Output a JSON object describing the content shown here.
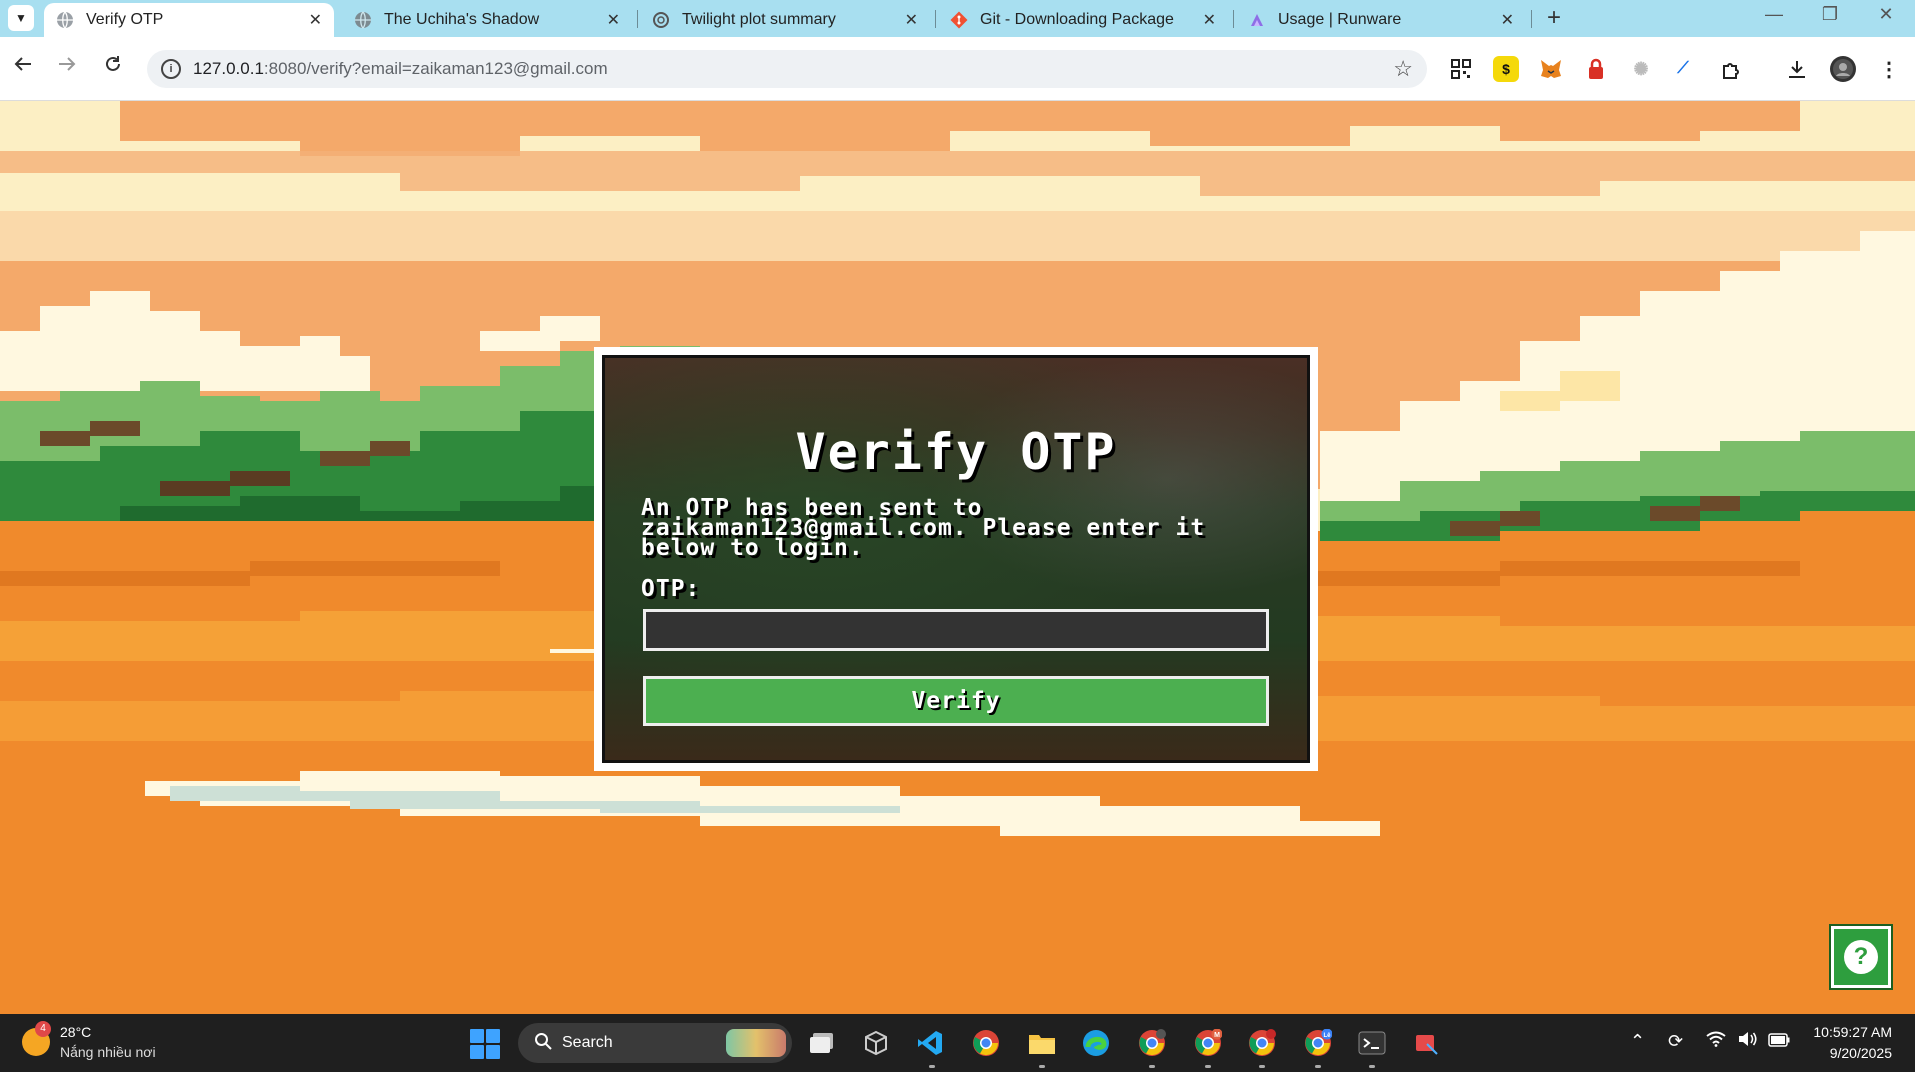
{
  "browser": {
    "tabs": [
      {
        "title": "Verify OTP",
        "favicon": "globe-icon",
        "active": true
      },
      {
        "title": "The Uchiha's Shadow",
        "favicon": "globe-icon",
        "active": false
      },
      {
        "title": "Twilight plot summary",
        "favicon": "openai-icon",
        "active": false
      },
      {
        "title": "Git - Downloading Package",
        "favicon": "git-icon",
        "active": false
      },
      {
        "title": "Usage | Runware",
        "favicon": "runware-icon",
        "active": false
      }
    ],
    "url": "127.0.0.1:8080/verify?email=zaikaman123@gmail.com",
    "url_host": "127.0.0.1",
    "url_rest": ":8080/verify?email=zaikaman123@gmail.com"
  },
  "page": {
    "title": "Verify OTP",
    "message": "An OTP has been sent to zaikaman123@gmail.com. Please enter it below to login.",
    "otp_label": "OTP:",
    "otp_value": "",
    "verify_label": "Verify",
    "help_label": "?"
  },
  "colors": {
    "accent": "#4caf50",
    "modal_border": "#ffffff",
    "sky": "#fcefc4",
    "ground": "#f08a2c"
  },
  "taskbar": {
    "weather_badge": "4",
    "weather_temp": "28°C",
    "weather_desc": "Nắng nhiều nơi",
    "search_label": "Search",
    "time": "10:59:27 AM",
    "date": "9/20/2025",
    "chrome_badge_m": "M",
    "chrome_badge_le": "Lê"
  }
}
